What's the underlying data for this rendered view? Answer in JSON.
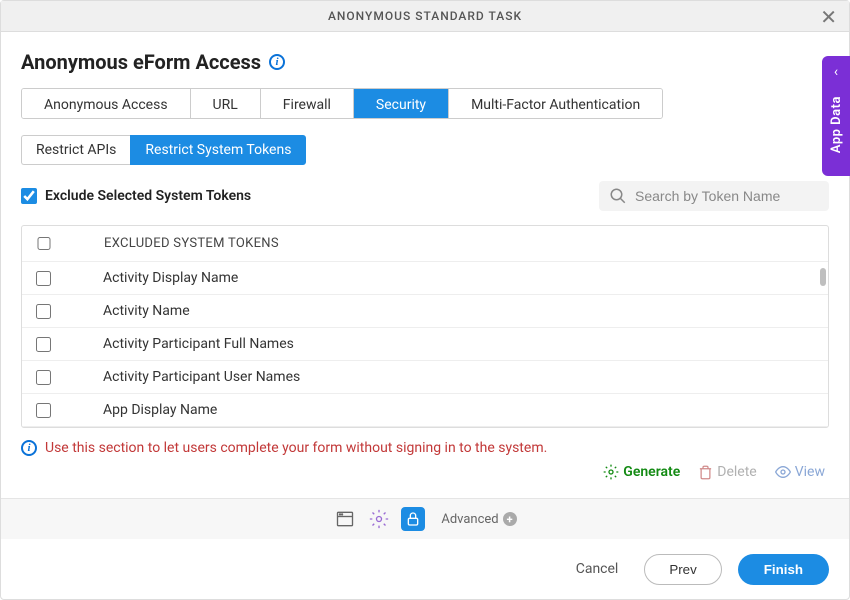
{
  "titlebar": {
    "text": "ANONYMOUS STANDARD TASK"
  },
  "page_title": "Anonymous eForm Access",
  "main_tabs": [
    {
      "label": "Anonymous Access",
      "active": false
    },
    {
      "label": "URL",
      "active": false
    },
    {
      "label": "Firewall",
      "active": false
    },
    {
      "label": "Security",
      "active": true
    },
    {
      "label": "Multi-Factor Authentication",
      "active": false
    }
  ],
  "sub_tabs": [
    {
      "label": "Restrict APIs",
      "active": false
    },
    {
      "label": "Restrict System Tokens",
      "active": true
    }
  ],
  "exclude": {
    "label": "Exclude Selected System Tokens",
    "checked": true
  },
  "search": {
    "placeholder": "Search by Token Name",
    "value": ""
  },
  "table": {
    "header": "EXCLUDED SYSTEM TOKENS",
    "rows": [
      {
        "label": "Activity Display Name"
      },
      {
        "label": "Activity Name"
      },
      {
        "label": "Activity Participant Full Names"
      },
      {
        "label": "Activity Participant User Names"
      },
      {
        "label": "App Display Name"
      }
    ]
  },
  "hint": "Use this section to let users complete your form without signing in to the system.",
  "actions": {
    "generate": "Generate",
    "delete": "Delete",
    "view": "View"
  },
  "toolbar": {
    "advanced": "Advanced"
  },
  "footer": {
    "cancel": "Cancel",
    "prev": "Prev",
    "finish": "Finish"
  },
  "side_tab": {
    "label": "App Data"
  }
}
